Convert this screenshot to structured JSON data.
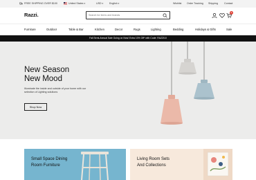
{
  "topbar": {
    "shipping": "FREE SHIPPING OVER $100",
    "country": "United States",
    "currency": "USD",
    "language": "English",
    "links": [
      "Wishlist",
      "Order Tracking",
      "Shipping",
      "Contact"
    ]
  },
  "header": {
    "logo": "Razzi.",
    "search_placeholder": "Search for items and brands",
    "cart_count": "2"
  },
  "nav": {
    "items": [
      "Furniture",
      "Outdoor",
      "Table & Bar",
      "Kitchen",
      "Decor",
      "Rugs",
      "Lighting",
      "Bedding",
      "Holidays & Gifts",
      "Sale"
    ]
  },
  "promo": {
    "text": "Fall Semi-Annual Sale Going on Now! Extra 10% Off* with Code: RAZZI10"
  },
  "hero": {
    "title_line1": "New Season",
    "title_line2": "New Mood",
    "description": "Illuminate the inside and outside of your home with our selection of Lighting solutions",
    "button": "Shop Now"
  },
  "cards": [
    {
      "line1": "Small Space Dining",
      "line2": "Room Furniture"
    },
    {
      "line1": "Living Room Sets",
      "line2": "And Collections"
    }
  ],
  "colors": {
    "promo_bg": "#111111",
    "hero_bg": "#ececeb",
    "card1_bg": "#76b5cf",
    "card2_bg": "#f7e9dc",
    "badge": "#e0453a",
    "lamp_pink": "#e9b4a4",
    "lamp_blue": "#a8bfca",
    "lamp_grey": "#d4d2cf"
  }
}
